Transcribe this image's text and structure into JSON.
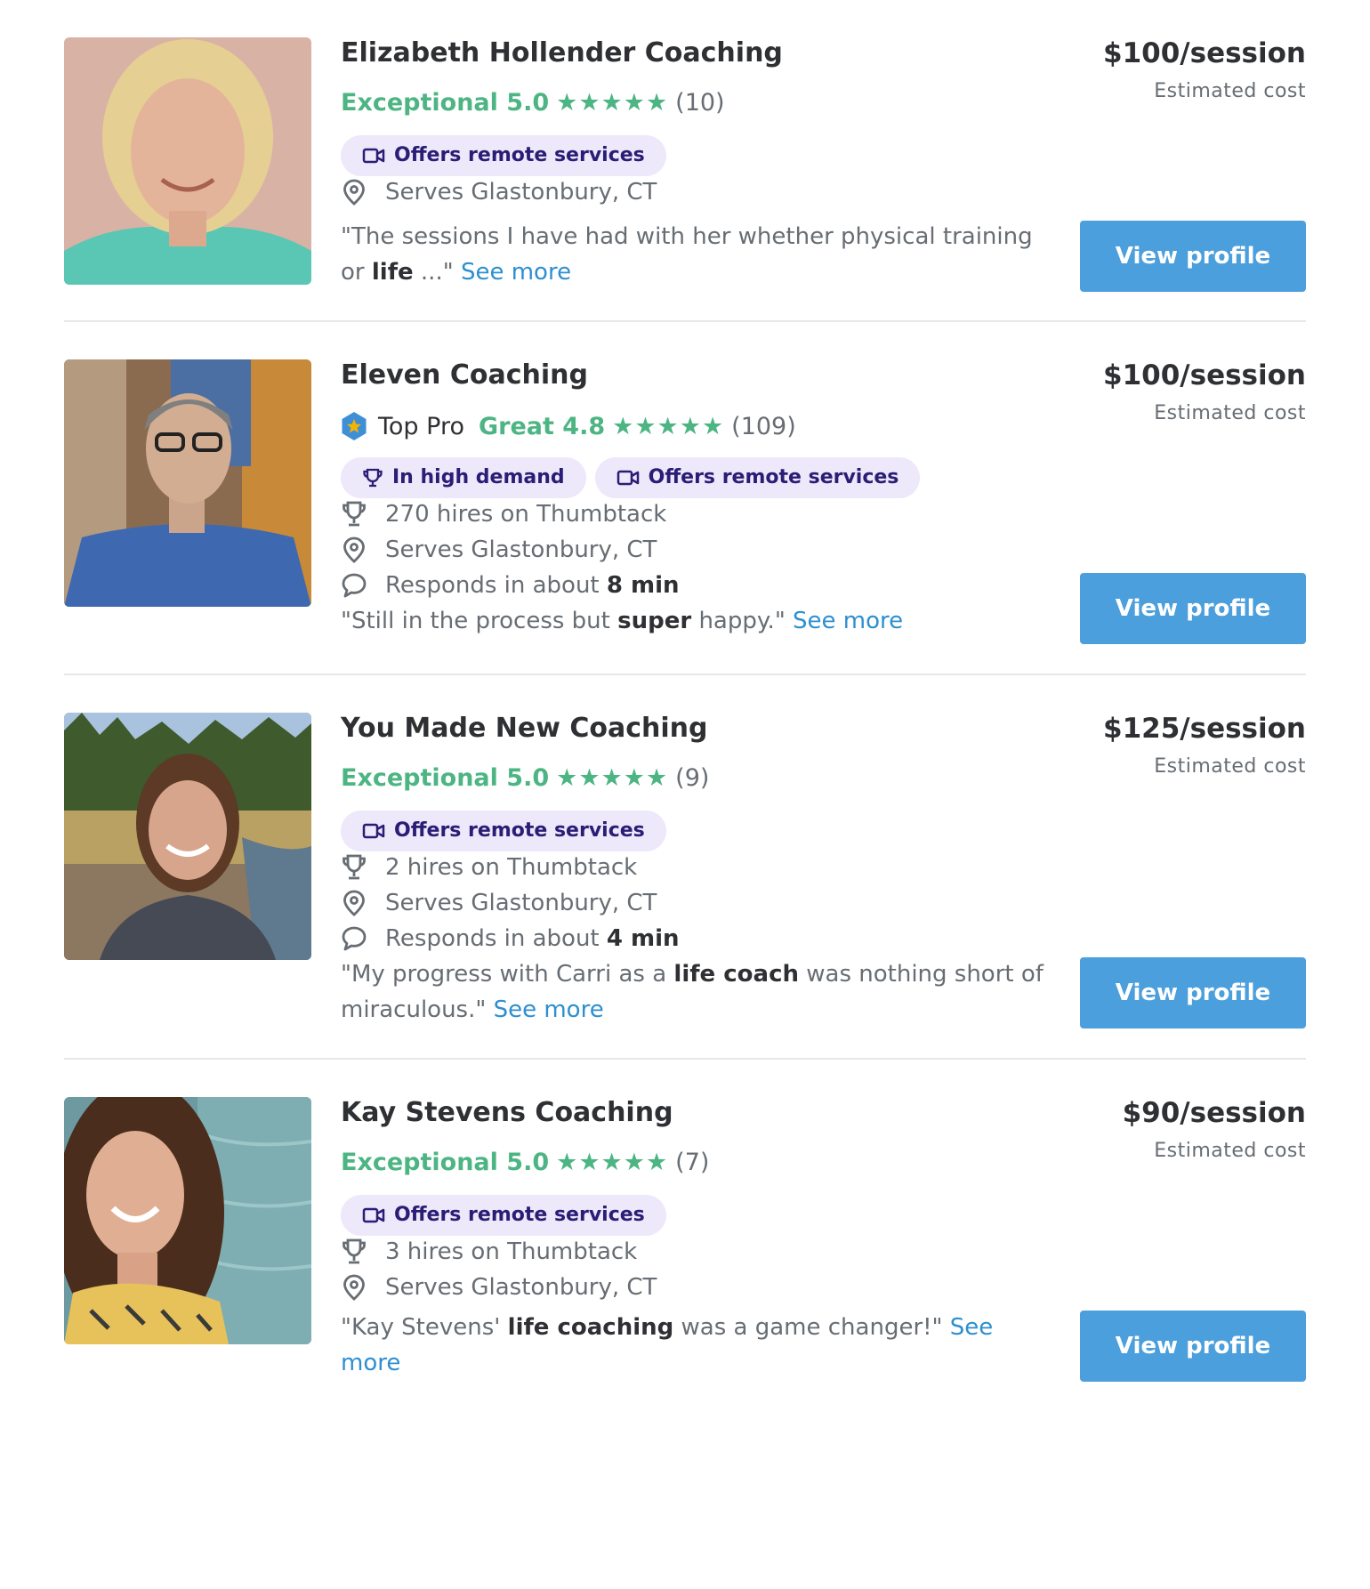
{
  "listings": [
    {
      "name": "Elizabeth Hollender Coaching",
      "rating_label": "Exceptional 5.0",
      "stars": "★★★★★",
      "review_count": "(10)",
      "badges": [
        "Offers remote services"
      ],
      "facts": [
        "Serves Glastonbury, CT"
      ],
      "quote_parts": [
        "\"The sessions I have had with her whether physical training or ",
        "life",
        " ...\""
      ],
      "see_more": "See more",
      "price": "$100/session",
      "price_note": "Estimated cost",
      "button": "View profile"
    },
    {
      "name": "Eleven Coaching",
      "top_pro": "Top Pro",
      "rating_label": "Great 4.8",
      "stars": "★★★★★",
      "review_count": "(109)",
      "badges": [
        "In high demand",
        "Offers remote services"
      ],
      "facts": [
        "270 hires on Thumbtack",
        "Serves Glastonbury, CT"
      ],
      "response": {
        "prefix": "Responds in about ",
        "time": "8 min"
      },
      "quote_parts": [
        "\"Still in the process but ",
        "super",
        " happy.\""
      ],
      "see_more": "See more",
      "price": "$100/session",
      "price_note": "Estimated cost",
      "button": "View profile"
    },
    {
      "name": "You Made New Coaching",
      "rating_label": "Exceptional 5.0",
      "stars": "★★★★★",
      "review_count": "(9)",
      "badges": [
        "Offers remote services"
      ],
      "facts": [
        "2 hires on Thumbtack",
        "Serves Glastonbury, CT"
      ],
      "response": {
        "prefix": "Responds in about ",
        "time": "4 min"
      },
      "quote_parts": [
        "\"My progress with Carri as a ",
        "life coach",
        " was nothing short of miraculous.\""
      ],
      "see_more": "See more",
      "price": "$125/session",
      "price_note": "Estimated cost",
      "button": "View profile"
    },
    {
      "name": "Kay Stevens Coaching",
      "rating_label": "Exceptional 5.0",
      "stars": "★★★★★",
      "review_count": "(7)",
      "badges": [
        "Offers remote services"
      ],
      "facts": [
        "3 hires on Thumbtack",
        "Serves Glastonbury, CT"
      ],
      "quote_parts": [
        "\"Kay Stevens' ",
        "life coaching",
        " was a game changer!\""
      ],
      "see_more": "See more",
      "price": "$90/session",
      "price_note": "Estimated cost",
      "button": "View profile"
    }
  ],
  "colors": {
    "rating_green": "#4db583",
    "badge_bg": "#ede8fa",
    "badge_text": "#2a1d75",
    "link_blue": "#2d8fd0",
    "button_blue": "#4b9fdc",
    "top_pro_blue": "#3f8fd6",
    "top_pro_star": "#f4b400"
  },
  "icons": {
    "remote": "video-camera-icon",
    "demand": "trophy-icon",
    "hires": "trophy-icon",
    "location": "map-pin-icon",
    "response": "chat-bubble-icon",
    "top_pro": "top-pro-hexagon-icon"
  }
}
